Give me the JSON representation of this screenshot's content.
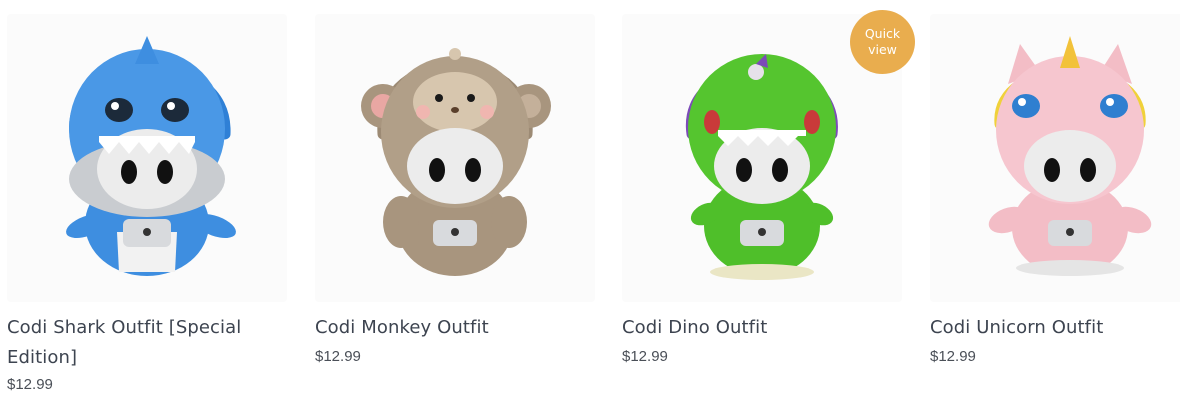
{
  "quick_view": {
    "label_line1": "Quick",
    "label_line2": "view"
  },
  "products": [
    {
      "title": "Codi Shark Outfit [Special Edition]",
      "price": "$12.99",
      "image_icon": "shark-plush-image",
      "color": "#3e8ee0"
    },
    {
      "title": "Codi Monkey Outfit",
      "price": "$12.99",
      "image_icon": "monkey-plush-image",
      "color": "#a8957e"
    },
    {
      "title": "Codi Dino Outfit",
      "price": "$12.99",
      "image_icon": "dino-plush-image",
      "color": "#4fbf2a"
    },
    {
      "title": "Codi Unicorn Outfit",
      "price": "$12.99",
      "image_icon": "unicorn-plush-image",
      "color": "#f3bdc6"
    }
  ],
  "colors": {
    "accent": "#e9ad4e",
    "text": "#3d4450",
    "price": "#4a4f57"
  }
}
